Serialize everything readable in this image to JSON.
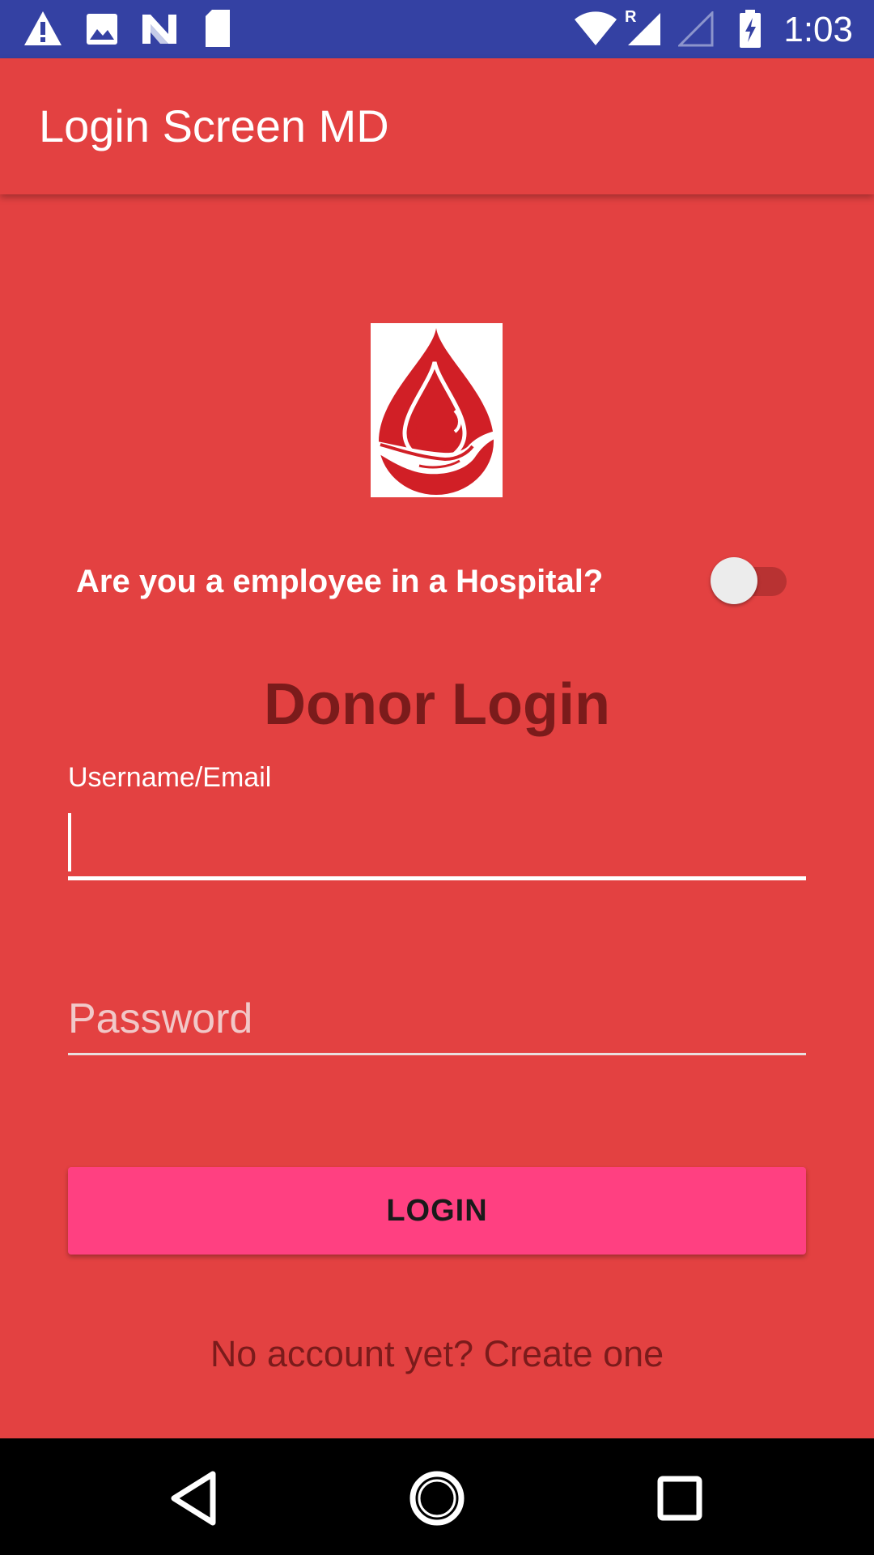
{
  "status_bar": {
    "time": "1:03",
    "icons": [
      "warning-icon",
      "image-icon",
      "n-logo-icon",
      "sd-card-moon-icon",
      "wifi-icon",
      "cell-signal-roaming-icon",
      "cell-signal-empty-icon",
      "battery-charging-icon"
    ],
    "roaming_label": "R",
    "background_color": "#3441a3"
  },
  "app_bar": {
    "title": "Login Screen MD",
    "background_color": "#e34141"
  },
  "logo": {
    "icon": "blood-drop-hand-icon",
    "color": "#d11f26"
  },
  "hospital_toggle": {
    "label": "Are you a employee in a Hospital?",
    "checked": false
  },
  "form": {
    "heading": "Donor Login",
    "username": {
      "label": "Username/Email",
      "value": ""
    },
    "password": {
      "placeholder": "Password",
      "value": ""
    },
    "login_button": "LOGIN",
    "create_account_link": "No account yet? Create one"
  },
  "nav_bar": {
    "buttons": [
      "back-icon",
      "home-icon",
      "recents-icon"
    ]
  },
  "colors": {
    "background": "#e34141",
    "accent": "#ff4081",
    "heading_text": "#7b1b1b"
  }
}
